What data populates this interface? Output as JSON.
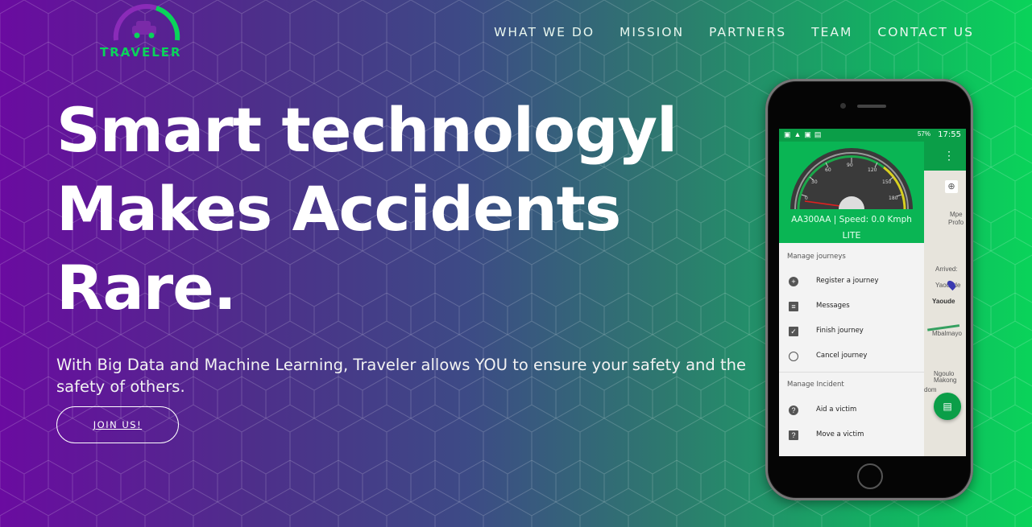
{
  "brand": {
    "name": "TRAVELER",
    "accent": "#0ad35a"
  },
  "nav": {
    "items": [
      "WHAT WE DO",
      "MISSION",
      "PARTNERS",
      "TEAM",
      "CONTACT US"
    ]
  },
  "hero": {
    "title_line1": "Smart technologyl",
    "title_line2": "Makes Accidents",
    "title_line3": "Rare.",
    "subtitle": "With Big Data and Machine Learning, Traveler allows YOU to ensure your safety and the safety of others.",
    "cta_label": "JOIN US!"
  },
  "phone": {
    "status_time": "17:55",
    "status_battery": "57%",
    "gauge_ticks": [
      "0",
      "30",
      "60",
      "90",
      "120",
      "150",
      "180"
    ],
    "plate_speed": "AA300AA | Speed: 0.0 Kmph",
    "edition": "LITE",
    "section1_label": "Manage journeys",
    "section1_items": [
      {
        "label": "Register a journey",
        "icon": "add-circle-icon"
      },
      {
        "label": "Messages",
        "icon": "chat-icon"
      },
      {
        "label": "Finish journey",
        "icon": "check-clipboard-icon"
      },
      {
        "label": "Cancel journey",
        "icon": "block-icon"
      }
    ],
    "section2_label": "Manage Incident",
    "section2_items": [
      {
        "label": "Aid a victim",
        "icon": "help-circle-icon"
      },
      {
        "label": "Move a victim",
        "icon": "help-box-icon"
      }
    ],
    "map_labels": [
      "Mpe",
      "Profo",
      "Arrived:",
      "Yaounde",
      "Yaoude",
      "Mbalmayo",
      "Ngoulo",
      "Makong",
      "dom"
    ]
  }
}
